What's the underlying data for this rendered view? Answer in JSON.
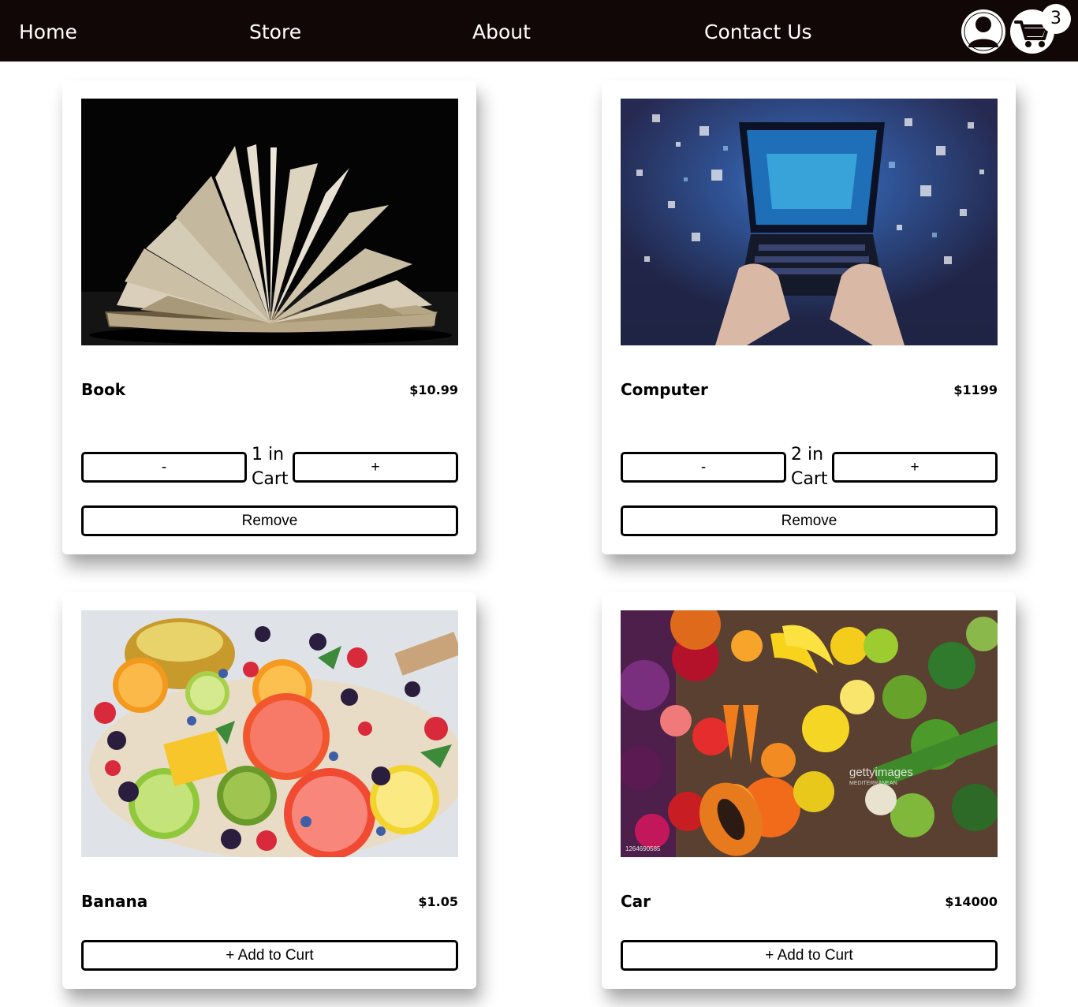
{
  "nav": {
    "home": "Home",
    "store": "Store",
    "about": "About",
    "contact": "Contact Us",
    "cart_count": "3"
  },
  "products": [
    {
      "name": "Book",
      "price": "$10.99",
      "qty_line1": "1 in",
      "qty_line2": "Cart",
      "minus": "-",
      "plus": "+",
      "remove": "Remove"
    },
    {
      "name": "Computer",
      "price": "$1199",
      "qty_line1": "2 in",
      "qty_line2": "Cart",
      "minus": "-",
      "plus": "+",
      "remove": "Remove"
    },
    {
      "name": "Banana",
      "price": "$1.05",
      "add": "+ Add to Curt"
    },
    {
      "name": "Car",
      "price": "$14000",
      "add": "+ Add to Curt"
    }
  ],
  "images": {
    "getty_watermark": "gettyimages",
    "getty_credit": "MEDITERRANEAN",
    "getty_id": "1264690585"
  },
  "icons": [
    "user-icon",
    "shopping-cart-icon"
  ],
  "colors": {
    "navbar": "#120707",
    "text_light": "#ffffff",
    "button_border": "#000000"
  }
}
